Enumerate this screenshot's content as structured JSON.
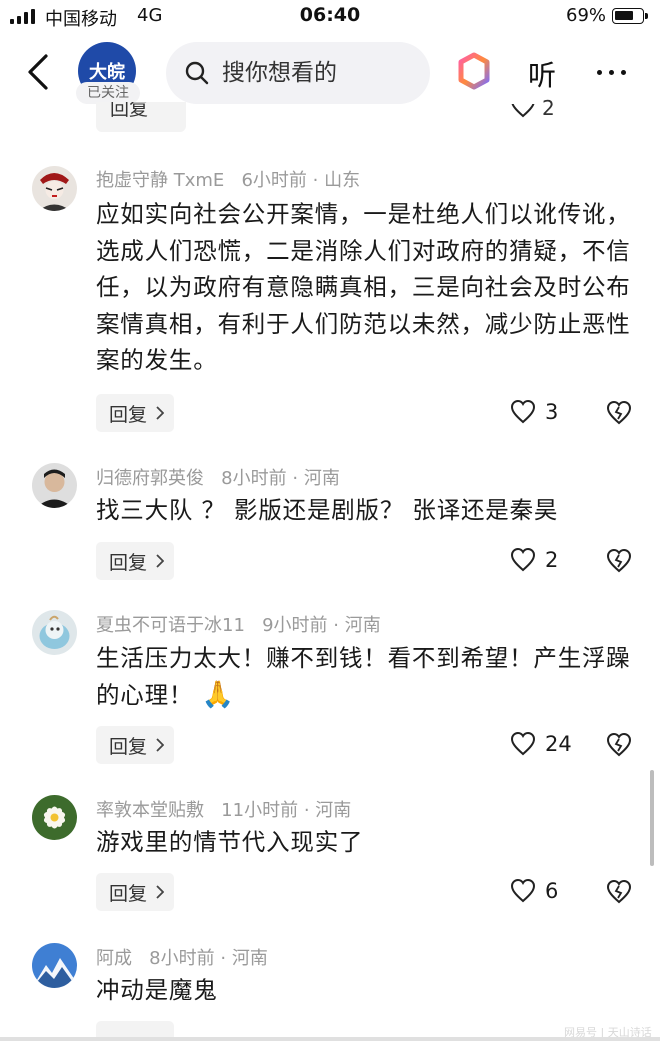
{
  "status_bar": {
    "carrier": "中国移动",
    "network": "4G",
    "time": "06:40",
    "battery": "69%"
  },
  "header": {
    "account_logo_text": "大皖",
    "follow_status": "已关注",
    "search_placeholder": "搜你想看的",
    "listen_label": "听"
  },
  "prev_comment": {
    "reply_label": "回复",
    "like_count": "2"
  },
  "comments": [
    {
      "username": "抱虚守静 TxmE",
      "time": "6小时前",
      "location": "山东",
      "text": "应如实向社会公开案情，一是杜绝人们以讹传讹，选成人们恐慌，二是消除人们对政府的猜疑，不信任，以为政府有意隐瞒真相，三是向社会及时公布案情真相，有利于人们防范以未然，减少防止恶性案的发生。",
      "reply_label": "回复",
      "likes": "3"
    },
    {
      "username": "归德府郭英俊",
      "time": "8小时前",
      "location": "河南",
      "text": "找三大队 ？ 影版还是剧版？ 张译还是秦昊",
      "reply_label": "回复",
      "likes": "2"
    },
    {
      "username": "夏虫不可语于冰11",
      "time": "9小时前",
      "location": "河南",
      "text": "生活压力太大！赚不到钱！看不到希望！产生浮躁的心理！",
      "emoji": "🙏",
      "reply_label": "回复",
      "likes": "24"
    },
    {
      "username": "率敦本堂贴敷",
      "time": "11小时前",
      "location": "河南",
      "text": "游戏里的情节代入现实了",
      "reply_label": "回复",
      "likes": "6"
    },
    {
      "username": "阿成",
      "time": "8小时前",
      "location": "河南",
      "text": "冲动是魔鬼"
    }
  ],
  "meta_separator": "·",
  "watermark": "网易号 | 天山诗话",
  "icons": {
    "back": "chevron-left-icon",
    "search": "search-icon",
    "ai": "ai-assistant-icon",
    "more": "more-dots-icon",
    "like": "heart-icon",
    "dislike": "broken-heart-icon",
    "reply_chevron": "chevron-right-icon"
  },
  "colors": {
    "logo_bg": "#1f4aa8",
    "meta_text": "#9a9a9a",
    "reply_bg": "#f3f3f3",
    "search_bg": "#f2f2f5"
  }
}
